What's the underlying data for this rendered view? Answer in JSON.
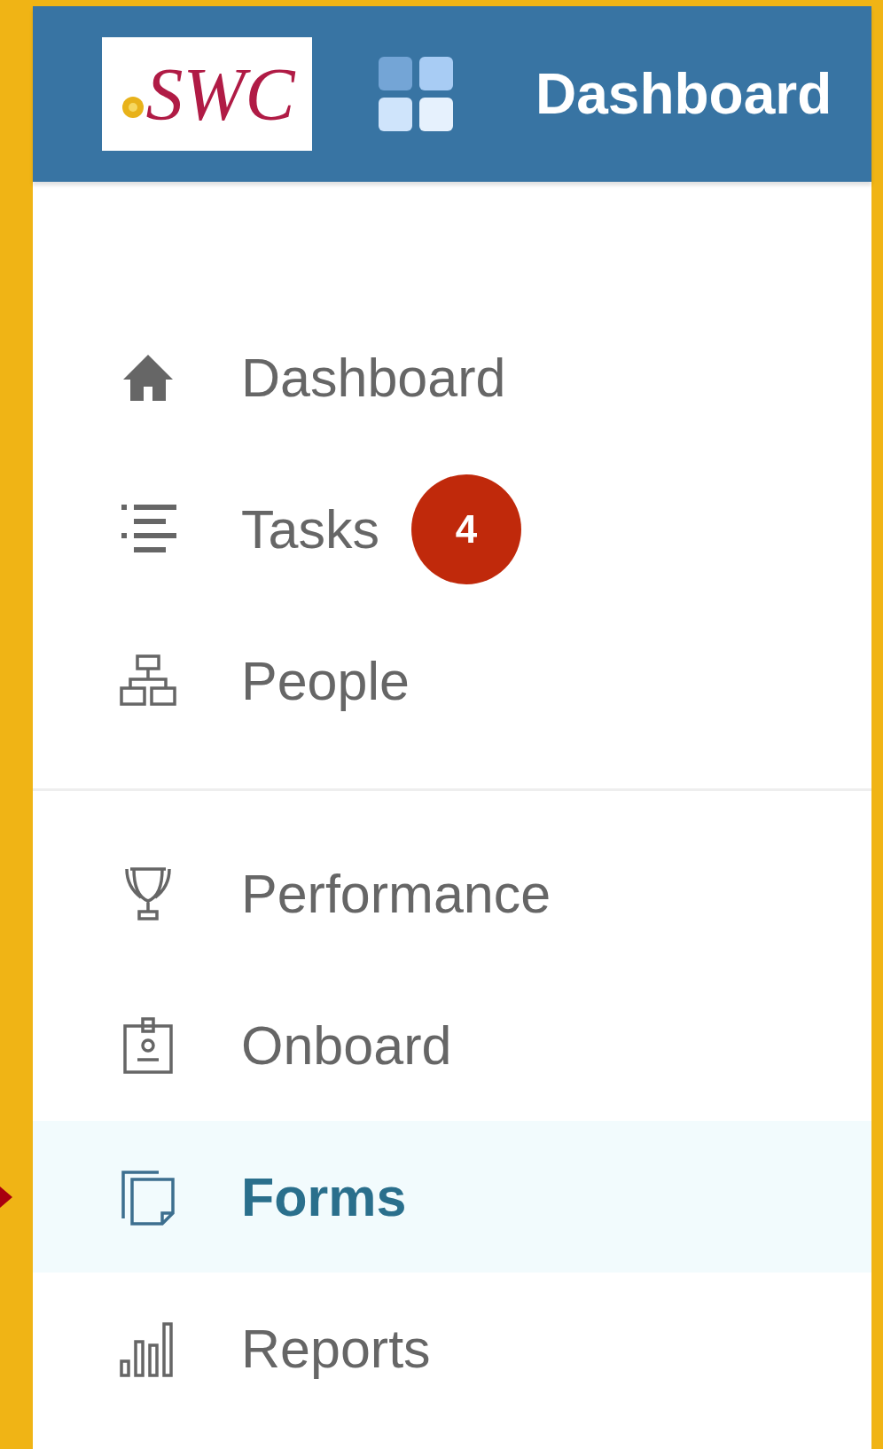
{
  "header": {
    "logo": {
      "text": "SWC"
    },
    "title": "Dashboard"
  },
  "nav_groups": [
    {
      "items": [
        {
          "label": "Dashboard",
          "selected": false
        },
        {
          "label": "Tasks",
          "selected": false,
          "badge": "4"
        },
        {
          "label": "People",
          "selected": false
        }
      ]
    },
    {
      "items": [
        {
          "label": "Performance",
          "selected": false
        },
        {
          "label": "Onboard",
          "selected": false
        },
        {
          "label": "Forms",
          "selected": true
        },
        {
          "label": "Reports",
          "selected": false
        }
      ]
    }
  ]
}
